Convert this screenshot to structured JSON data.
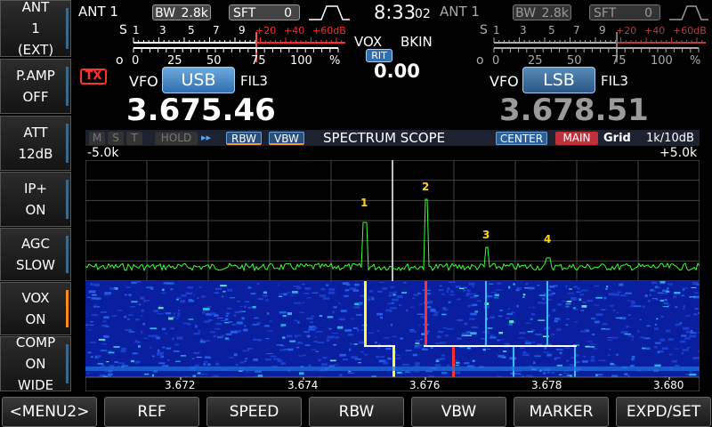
{
  "side": [
    {
      "l1": "ANT",
      "l2": "1",
      "l3": "(EXT)"
    },
    {
      "l1": "P.AMP",
      "l2": "OFF"
    },
    {
      "l1": "ATT",
      "l2": "12dB"
    },
    {
      "l1": "IP+",
      "l2": "ON"
    },
    {
      "l1": "AGC",
      "l2": "SLOW"
    },
    {
      "l1": "VOX",
      "l2": "ON"
    },
    {
      "l1": "COMP",
      "l2": "ON",
      "l3": "WIDE"
    }
  ],
  "bottom": [
    "<MENU2>",
    "REF",
    "SPEED",
    "RBW",
    "VBW",
    "MARKER",
    "EXPD/SET"
  ],
  "main": {
    "ant": "ANT 1",
    "bw_label": "BW",
    "bw": "2.8k",
    "sft_label": "SFT",
    "sft": "0",
    "vfo_label": "VFO",
    "mode": "USB",
    "fil": "FIL3",
    "freq": "3.675.46",
    "tx": "TX"
  },
  "sub": {
    "ant": "ANT 1",
    "bw_label": "BW",
    "bw": "2.8k",
    "sft_label": "SFT",
    "sft": "0",
    "vfo_label": "VFO",
    "mode": "LSB",
    "fil": "FIL3",
    "freq": "3.678.51"
  },
  "clock": {
    "hm": "8:33",
    "s": "02"
  },
  "center": {
    "vox": "VOX",
    "bkin": "BKIN",
    "rit": "RIT",
    "rit_val": "0.00"
  },
  "meter": {
    "s_label": "S",
    "po_label": "Po",
    "s_ticks": [
      "1",
      "3",
      "5",
      "7",
      "9",
      "+20",
      "+40",
      "+60dB"
    ],
    "po_ticks": [
      "0",
      "25",
      "50",
      "75",
      "100",
      "%"
    ]
  },
  "scope": {
    "tags": [
      "M",
      "S",
      "T",
      "HOLD"
    ],
    "rbw": "RBW",
    "vbw": "VBW",
    "title": "SPECTRUM SCOPE",
    "center": "CENTER",
    "main": "MAIN",
    "grid": "Grid",
    "span": "1k/10dB",
    "left_span": "-5.0k",
    "right_span": "+5.0k",
    "markers": [
      "1",
      "2",
      "3",
      "4"
    ],
    "freq_ticks": [
      "3.672",
      "3.674",
      "3.676",
      "3.678",
      "3.680"
    ]
  },
  "colors": {
    "accent": "#2f6fb0",
    "tx": "#ff3030",
    "marker": "#ffd21e",
    "meter_red": "#ff2a2a"
  }
}
